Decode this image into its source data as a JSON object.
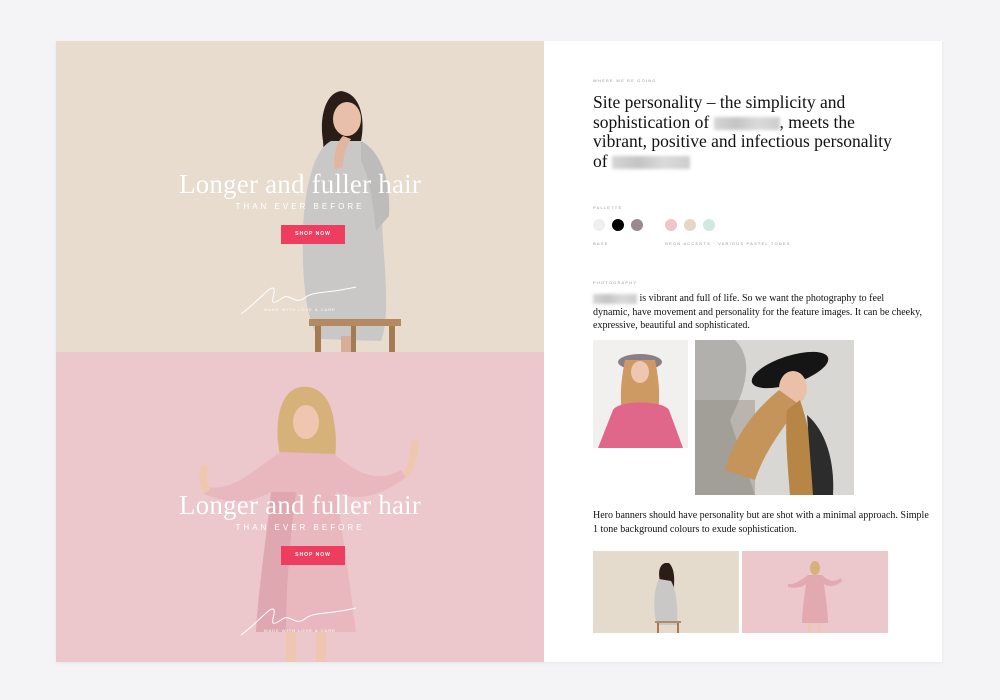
{
  "hero": {
    "title": "Longer and fuller hair",
    "subtitle": "THAN EVER BEFORE",
    "button": "SHOP NOW",
    "footer": "MADE WITH LOVE & CARE"
  },
  "right": {
    "section1_label": "WHERE WE'RE GOING",
    "heading_part1": "Site personality – the simplicity and sophistication of",
    "heading_part2": ", meets the vibrant, positive and infectious personality of",
    "palette_label": "PALLETTE",
    "palette_base_label": "BASE",
    "palette_accent_label": "NEON ACCENTS · VARIOUS PASTEL TONES",
    "palette_colors": [
      "#efefef",
      "#000000",
      "#9a8a90",
      "#eec5c9",
      "#e6d6c7",
      "#cfe8e1"
    ],
    "photography_label": "PHOTOGRAPHY",
    "photography_text": " is vibrant and full of life. So we want the photography to feel dynamic, have movement and personality for the feature images. It can be cheeky, expressive, beautiful and sophisticated.",
    "hero_text": "Hero banners should have personality but are shot with a minimal approach. Simple 1 tone background colours to exude sophistication."
  }
}
